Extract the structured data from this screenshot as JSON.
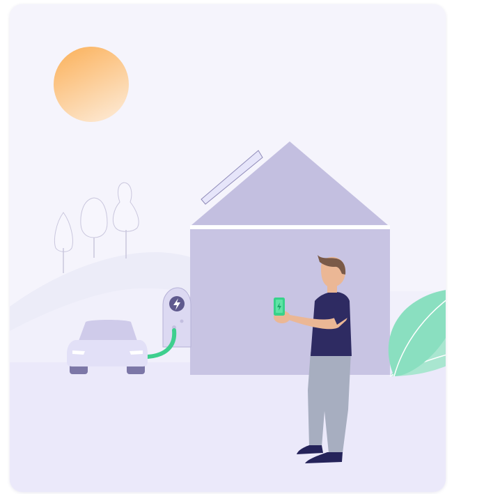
{
  "scene": {
    "sky": "#f5f4fc",
    "ground": "#ebe9fa",
    "hill_far": "#ececf8",
    "hill_near": "#f1f0fb",
    "tree_fill": "#f7f6fd",
    "tree_stroke": "#c9c6dd",
    "house_wall": "#c8c4e3",
    "house_roof": "#c3bfe0",
    "solar_panel": "#e6e5fa",
    "charger_body": "#dcd9f2",
    "charger_icon_bg": "#5f5a8e",
    "cable": "#3ecf8e",
    "car_body": "#e2e0f7",
    "car_roof": "#cfcbea",
    "car_wheels": "#7c77a7",
    "sun_top": "#fbb563",
    "sun_bottom": "#fde8d1",
    "phone": "#37d28a",
    "shirt": "#2e2b62",
    "pants": "#a7aec0",
    "shoes": "#25235a",
    "skin": "#ebb795",
    "hair": "#7a5a48",
    "leaf_front": "#8adfc0",
    "leaf_back": "#a9e6d0",
    "icons": [
      "sun-icon",
      "tree-icon",
      "house-icon",
      "solar-panel-icon",
      "ev-charger-icon",
      "lightning-bolt-icon",
      "car-icon",
      "person-icon",
      "smartphone-icon",
      "leaf-icon"
    ]
  }
}
